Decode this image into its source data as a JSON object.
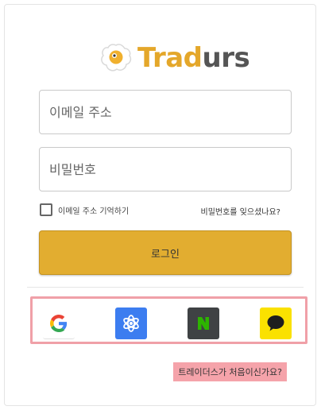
{
  "brand": {
    "name_part1": "Trad",
    "name_part2": "urs",
    "accent_color": "#e4a72a",
    "logo_icon": "egg-icon"
  },
  "form": {
    "email_placeholder": "이메일 주소",
    "email_value": "",
    "password_placeholder": "비밀번호",
    "password_value": "",
    "remember_label": "이메일 주소 기억하기",
    "remember_checked": false,
    "forgot_link": "비밀번호를 잊으셨나요?",
    "login_label": "로그인"
  },
  "social": [
    {
      "provider": "google",
      "icon": "google-icon",
      "color": "#ffffff"
    },
    {
      "provider": "trello-style",
      "icon": "atom-icon",
      "color": "#3c7df0"
    },
    {
      "provider": "naver",
      "icon": "naver-n-icon",
      "color": "#3f4244"
    },
    {
      "provider": "kakao",
      "icon": "kakao-chat-icon",
      "color": "#fae100"
    }
  ],
  "signup_link": "트레이더스가 처음이신가요?",
  "highlight_color": "#f0a0a8"
}
